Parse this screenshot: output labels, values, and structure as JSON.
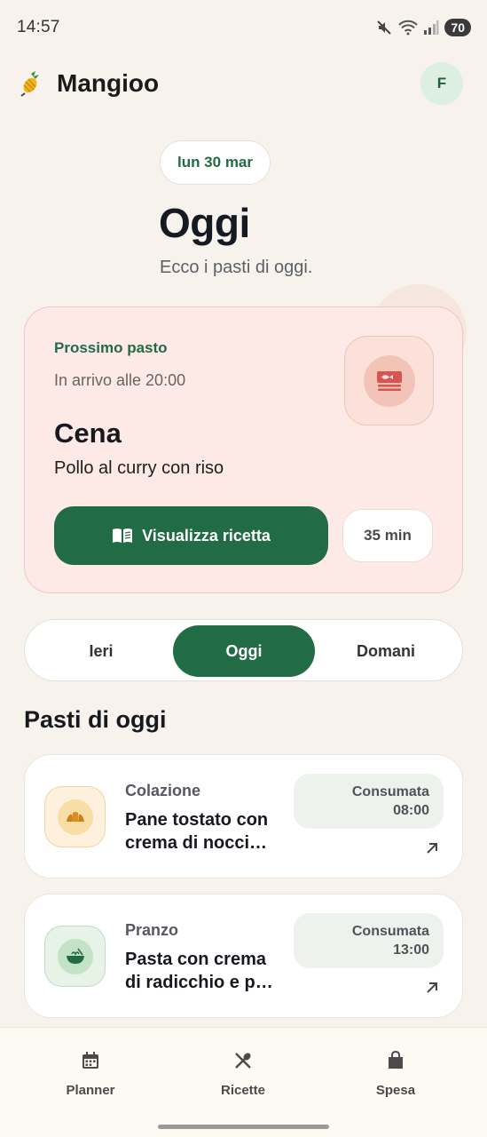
{
  "status_bar": {
    "time": "14:57",
    "battery": "70"
  },
  "app": {
    "title": "Mangioo",
    "avatar_initial": "F"
  },
  "header": {
    "date_chip": "lun 30 mar",
    "title": "Oggi",
    "subtitle": "Ecco i pasti di oggi."
  },
  "next_meal": {
    "label": "Prossimo pasto",
    "time_text": "In arrivo alle 20:00",
    "meal": "Cena",
    "dish": "Pollo al curry con riso",
    "button_label": "Visualizza ricetta",
    "duration": "35 min",
    "icon": "dinner-plate-icon"
  },
  "day_tabs": [
    {
      "label": "Ieri",
      "active": false
    },
    {
      "label": "Oggi",
      "active": true
    },
    {
      "label": "Domani",
      "active": false
    }
  ],
  "section_title": "Pasti di oggi",
  "meals": [
    {
      "type": "Colazione",
      "name_line1": "Pane tostato con",
      "name_line2": "crema di nocci…",
      "status": "Consumata",
      "time": "08:00",
      "icon": "croissant-icon"
    },
    {
      "type": "Pranzo",
      "name_line1": "Pasta con crema",
      "name_line2": "di radicchio e p…",
      "status": "Consumata",
      "time": "13:00",
      "icon": "bowl-icon"
    }
  ],
  "bottom_nav": [
    {
      "label": "Planner",
      "icon": "calendar-icon"
    },
    {
      "label": "Ricette",
      "icon": "utensils-icon"
    },
    {
      "label": "Spesa",
      "icon": "shopping-bag-icon"
    }
  ],
  "colors": {
    "primary": "#216b45",
    "background": "#f7f3ec",
    "next_card": "#fde9e5"
  }
}
